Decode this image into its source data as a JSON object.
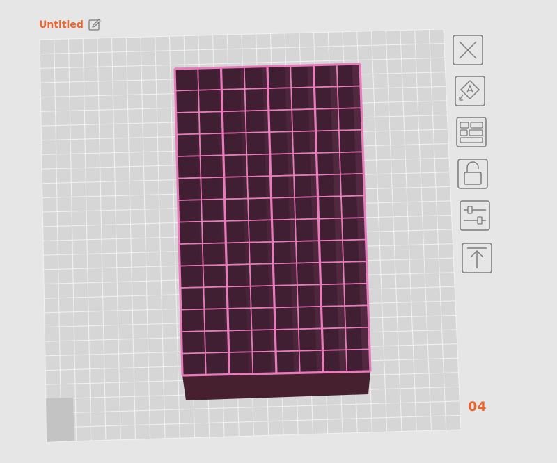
{
  "document": {
    "title": "Untitled"
  },
  "scene": {
    "plate_color": "#d6d6d6",
    "grid_color": "#f2f2f2",
    "corner_marker_color": "#c3c3c3",
    "model": {
      "type": "grid-organizer-box",
      "columns": 8,
      "rows": 14,
      "divider_groups": 4,
      "fill_color": "#3f1f31",
      "wall_color": "#e77bbb",
      "side_color": "#46202f"
    }
  },
  "toolbar": {
    "buttons": [
      {
        "id": "close",
        "icon": "close-icon"
      },
      {
        "id": "auto-orient",
        "icon": "auto-orient-icon"
      },
      {
        "id": "arrange",
        "icon": "arrange-icon"
      },
      {
        "id": "lock",
        "icon": "unlock-icon"
      },
      {
        "id": "settings",
        "icon": "sliders-icon"
      },
      {
        "id": "lay-flat",
        "icon": "arrow-up-to-line-icon"
      }
    ]
  },
  "page": {
    "number": "04"
  },
  "colors": {
    "accent": "#e8652f",
    "icon_stroke": "#7b7b7b"
  }
}
